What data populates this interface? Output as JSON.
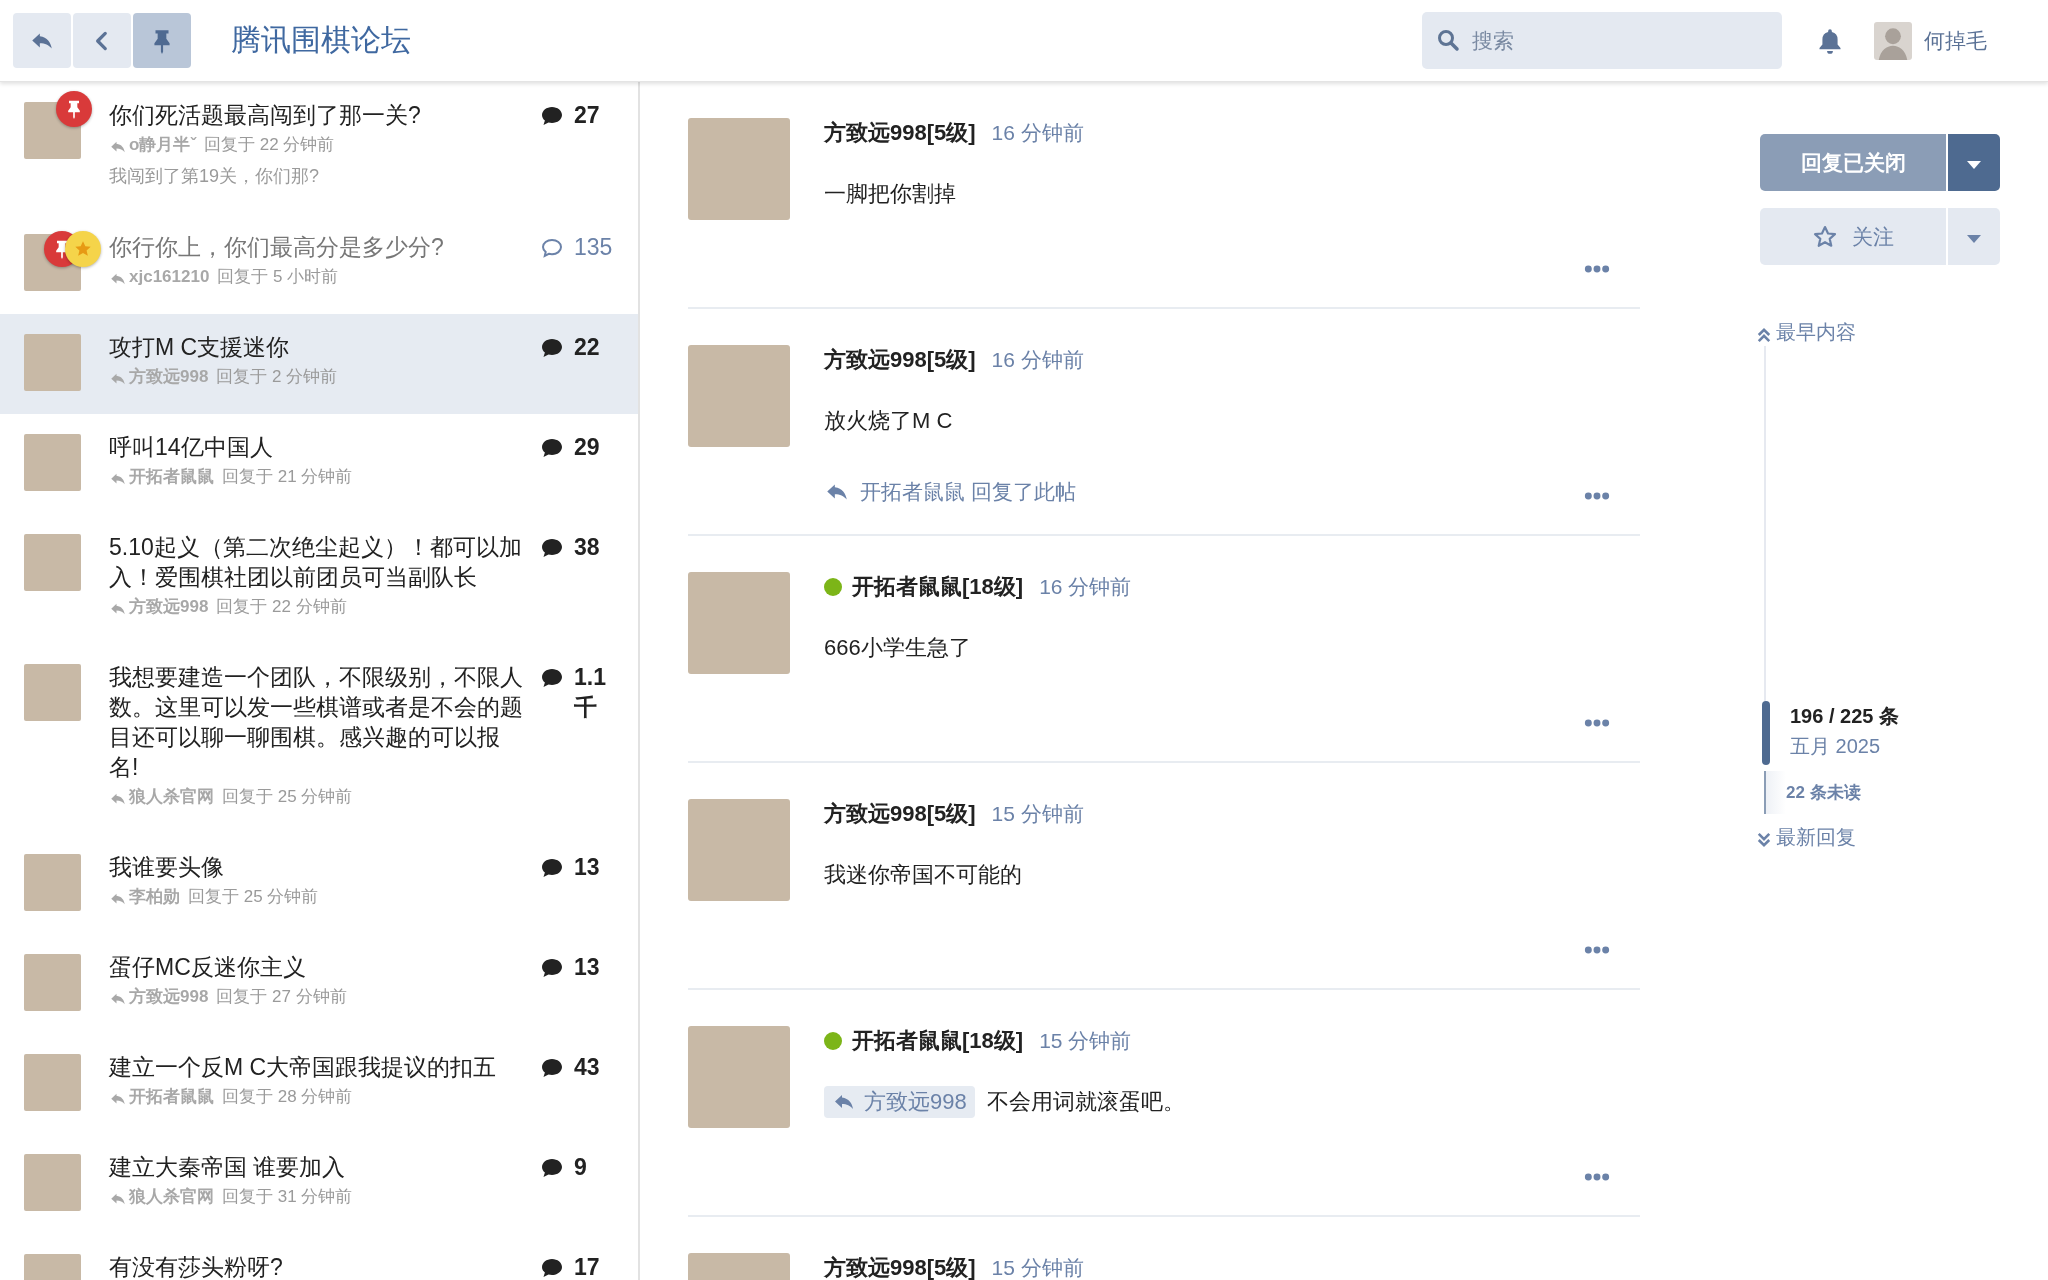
{
  "header": {
    "nav_buttons": [
      {
        "kind": "reply",
        "selected": false
      },
      {
        "kind": "back",
        "selected": false
      },
      {
        "kind": "pin",
        "selected": true
      }
    ],
    "title": "腾讯围棋论坛",
    "search": {
      "placeholder": "搜索"
    },
    "user": {
      "name": "何掉毛"
    }
  },
  "topics": [
    {
      "title": "你们死活题最高闯到了那一关?",
      "read": false,
      "selected": false,
      "pinned": true,
      "starred": false,
      "last_poster": "o静月半ˇ",
      "reply_time": "回复于 22 分钟前",
      "excerpt": "我闯到了第19关，你们那?",
      "count": "27"
    },
    {
      "title": "你行你上，你们最高分是多少分?",
      "read": true,
      "selected": false,
      "pinned": true,
      "starred": true,
      "last_poster": "xjc161210",
      "reply_time": "回复于 5 小时前",
      "count": "135"
    },
    {
      "title": "攻打M C支援迷你",
      "read": false,
      "selected": true,
      "pinned": false,
      "starred": false,
      "last_poster": "方致远998",
      "reply_time": "回复于 2 分钟前",
      "count": "22"
    },
    {
      "title": "呼叫14亿中国人",
      "read": false,
      "selected": false,
      "pinned": false,
      "starred": false,
      "last_poster": "开拓者鼠鼠",
      "reply_time": "回复于 21 分钟前",
      "count": "29"
    },
    {
      "title": "5.10起义（第二次绝尘起义）！都可以加入！爱围棋社团以前团员可当副队长",
      "read": false,
      "selected": false,
      "pinned": false,
      "starred": false,
      "last_poster": "方致远998",
      "reply_time": "回复于 22 分钟前",
      "count": "38"
    },
    {
      "title": "我想要建造一个团队，不限级别，不限人数。这里可以发一些棋谱或者是不会的题目还可以聊一聊围棋。感兴趣的可以报名!",
      "read": false,
      "selected": false,
      "pinned": false,
      "starred": false,
      "last_poster": "狼人杀官网",
      "reply_time": "回复于 25 分钟前",
      "count": "1.1千"
    },
    {
      "title": "我谁要头像",
      "read": false,
      "selected": false,
      "pinned": false,
      "starred": false,
      "last_poster": "李柏勋",
      "reply_time": "回复于 25 分钟前",
      "count": "13"
    },
    {
      "title": "蛋仔MC反迷你主义",
      "read": false,
      "selected": false,
      "pinned": false,
      "starred": false,
      "last_poster": "方致远998",
      "reply_time": "回复于 27 分钟前",
      "count": "13"
    },
    {
      "title": "建立一个反M C大帝国跟我提议的扣五",
      "read": false,
      "selected": false,
      "pinned": false,
      "starred": false,
      "last_poster": "开拓者鼠鼠",
      "reply_time": "回复于 28 分钟前",
      "count": "43"
    },
    {
      "title": "建立大秦帝国 谁要加入",
      "read": false,
      "selected": false,
      "pinned": false,
      "starred": false,
      "last_poster": "狼人杀官网",
      "reply_time": "回复于 31 分钟前",
      "count": "9"
    },
    {
      "title": "有没有莎头粉呀?",
      "read": false,
      "selected": false,
      "pinned": false,
      "starred": false,
      "count": "17"
    }
  ],
  "posts": [
    {
      "author": "方致远998[5级]",
      "online": false,
      "time": "16 分钟前",
      "body": "一脚把你割掉"
    },
    {
      "author": "方致远998[5级]",
      "online": false,
      "time": "16 分钟前",
      "body": "放火烧了M C",
      "replied_by": "开拓者鼠鼠 回复了此帖"
    },
    {
      "author": "开拓者鼠鼠[18级]",
      "online": true,
      "time": "16 分钟前",
      "body": "666小学生急了"
    },
    {
      "author": "方致远998[5级]",
      "online": false,
      "time": "15 分钟前",
      "body": "我迷你帝国不可能的"
    },
    {
      "author": "开拓者鼠鼠[18级]",
      "online": true,
      "time": "15 分钟前",
      "reply_to": "方致远998",
      "body": "不会用词就滚蛋吧。"
    },
    {
      "author": "方致远998[5级]",
      "online": false,
      "time": "15 分钟前"
    }
  ],
  "sidebar": {
    "reply_button": {
      "label": "回复已关闭",
      "disabled": true
    },
    "watch_button": {
      "label": "关注"
    },
    "timeline": {
      "top": "最早内容",
      "position": "196 / 225 条",
      "date": "五月 2025",
      "unread": "22 条未读",
      "bottom": "最新回复"
    }
  }
}
